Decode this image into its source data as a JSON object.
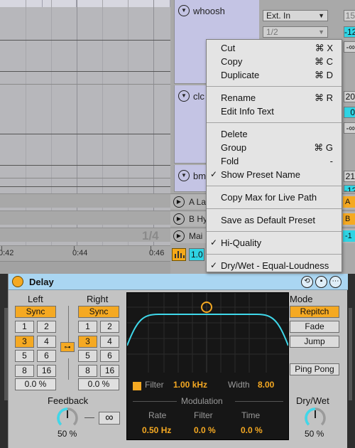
{
  "arrangement": {
    "loop_position": "1/4",
    "ruler_labels": [
      "0:42",
      "0:44",
      "0:46"
    ]
  },
  "tracks": [
    {
      "name": "whoosh",
      "input_type": "Ext. In",
      "input_channel": "1/2",
      "volume": "-12",
      "volume_top": "15",
      "pan": "-∞"
    },
    {
      "name": "clc",
      "volume": "20",
      "send": "0",
      "pan": "-∞"
    },
    {
      "name": "bm",
      "volume": "21",
      "send": "-12"
    }
  ],
  "returns": [
    {
      "name": "A La",
      "chip": "A"
    },
    {
      "name": "B Hy",
      "chip": "B"
    },
    {
      "name": "Mai",
      "chip": "-1"
    }
  ],
  "zoom_value": "1.0",
  "context_menu": {
    "groups": [
      [
        {
          "label": "Cut",
          "shortcut": "⌘ X"
        },
        {
          "label": "Copy",
          "shortcut": "⌘ C"
        },
        {
          "label": "Duplicate",
          "shortcut": "⌘ D"
        }
      ],
      [
        {
          "label": "Rename",
          "shortcut": "⌘ R"
        },
        {
          "label": "Edit Info Text",
          "shortcut": ""
        }
      ],
      [
        {
          "label": "Delete",
          "shortcut": ""
        },
        {
          "label": "Group",
          "shortcut": "⌘ G"
        },
        {
          "label": "Fold",
          "shortcut": "-"
        },
        {
          "label": "Show Preset Name",
          "shortcut": "",
          "checked": true
        }
      ],
      [
        {
          "label": "Copy Max for Live Path",
          "shortcut": ""
        }
      ],
      [
        {
          "label": "Save as Default Preset",
          "shortcut": ""
        }
      ],
      [
        {
          "label": "Hi-Quality",
          "shortcut": "",
          "checked": true
        }
      ],
      [
        {
          "label": "Dry/Wet - Equal-Loudness",
          "shortcut": "",
          "checked": true
        }
      ]
    ]
  },
  "device": {
    "title": "Delay",
    "title_icons": [
      "swap-icon",
      "save-icon",
      "more-icon"
    ],
    "left": {
      "label": "Left",
      "sync": "Sync",
      "beats": [
        "1",
        "2",
        "3",
        "4",
        "5",
        "6",
        "8",
        "16"
      ],
      "selected": "3",
      "offset": "0.0 %"
    },
    "right": {
      "label": "Right",
      "sync": "Sync",
      "beats": [
        "1",
        "2",
        "3",
        "4",
        "5",
        "6",
        "8",
        "16"
      ],
      "selected": "3",
      "offset": "0.0 %"
    },
    "display": {
      "filter_label": "Filter",
      "filter_value": "1.00 kHz",
      "width_label": "Width",
      "width_value": "8.00",
      "modulation_label": "Modulation",
      "mod_rate_label": "Rate",
      "mod_rate_value": "0.50 Hz",
      "mod_filter_label": "Filter",
      "mod_filter_value": "0.0 %",
      "mod_time_label": "Time",
      "mod_time_value": "0.0 %"
    },
    "mode": {
      "label": "Mode",
      "options": [
        "Repitch",
        "Fade",
        "Jump"
      ],
      "selected": "Repitch"
    },
    "ping_pong": "Ping Pong",
    "feedback": {
      "label": "Feedback",
      "value": "50 %",
      "level": 0.5
    },
    "freeze_symbol": "∞",
    "dry_wet": {
      "label": "Dry/Wet",
      "value": "50 %",
      "level": 0.5
    },
    "colors": {
      "accent": "#f5a922",
      "curve": "#3fd8ea",
      "title_bar": "#aad6f2"
    }
  }
}
